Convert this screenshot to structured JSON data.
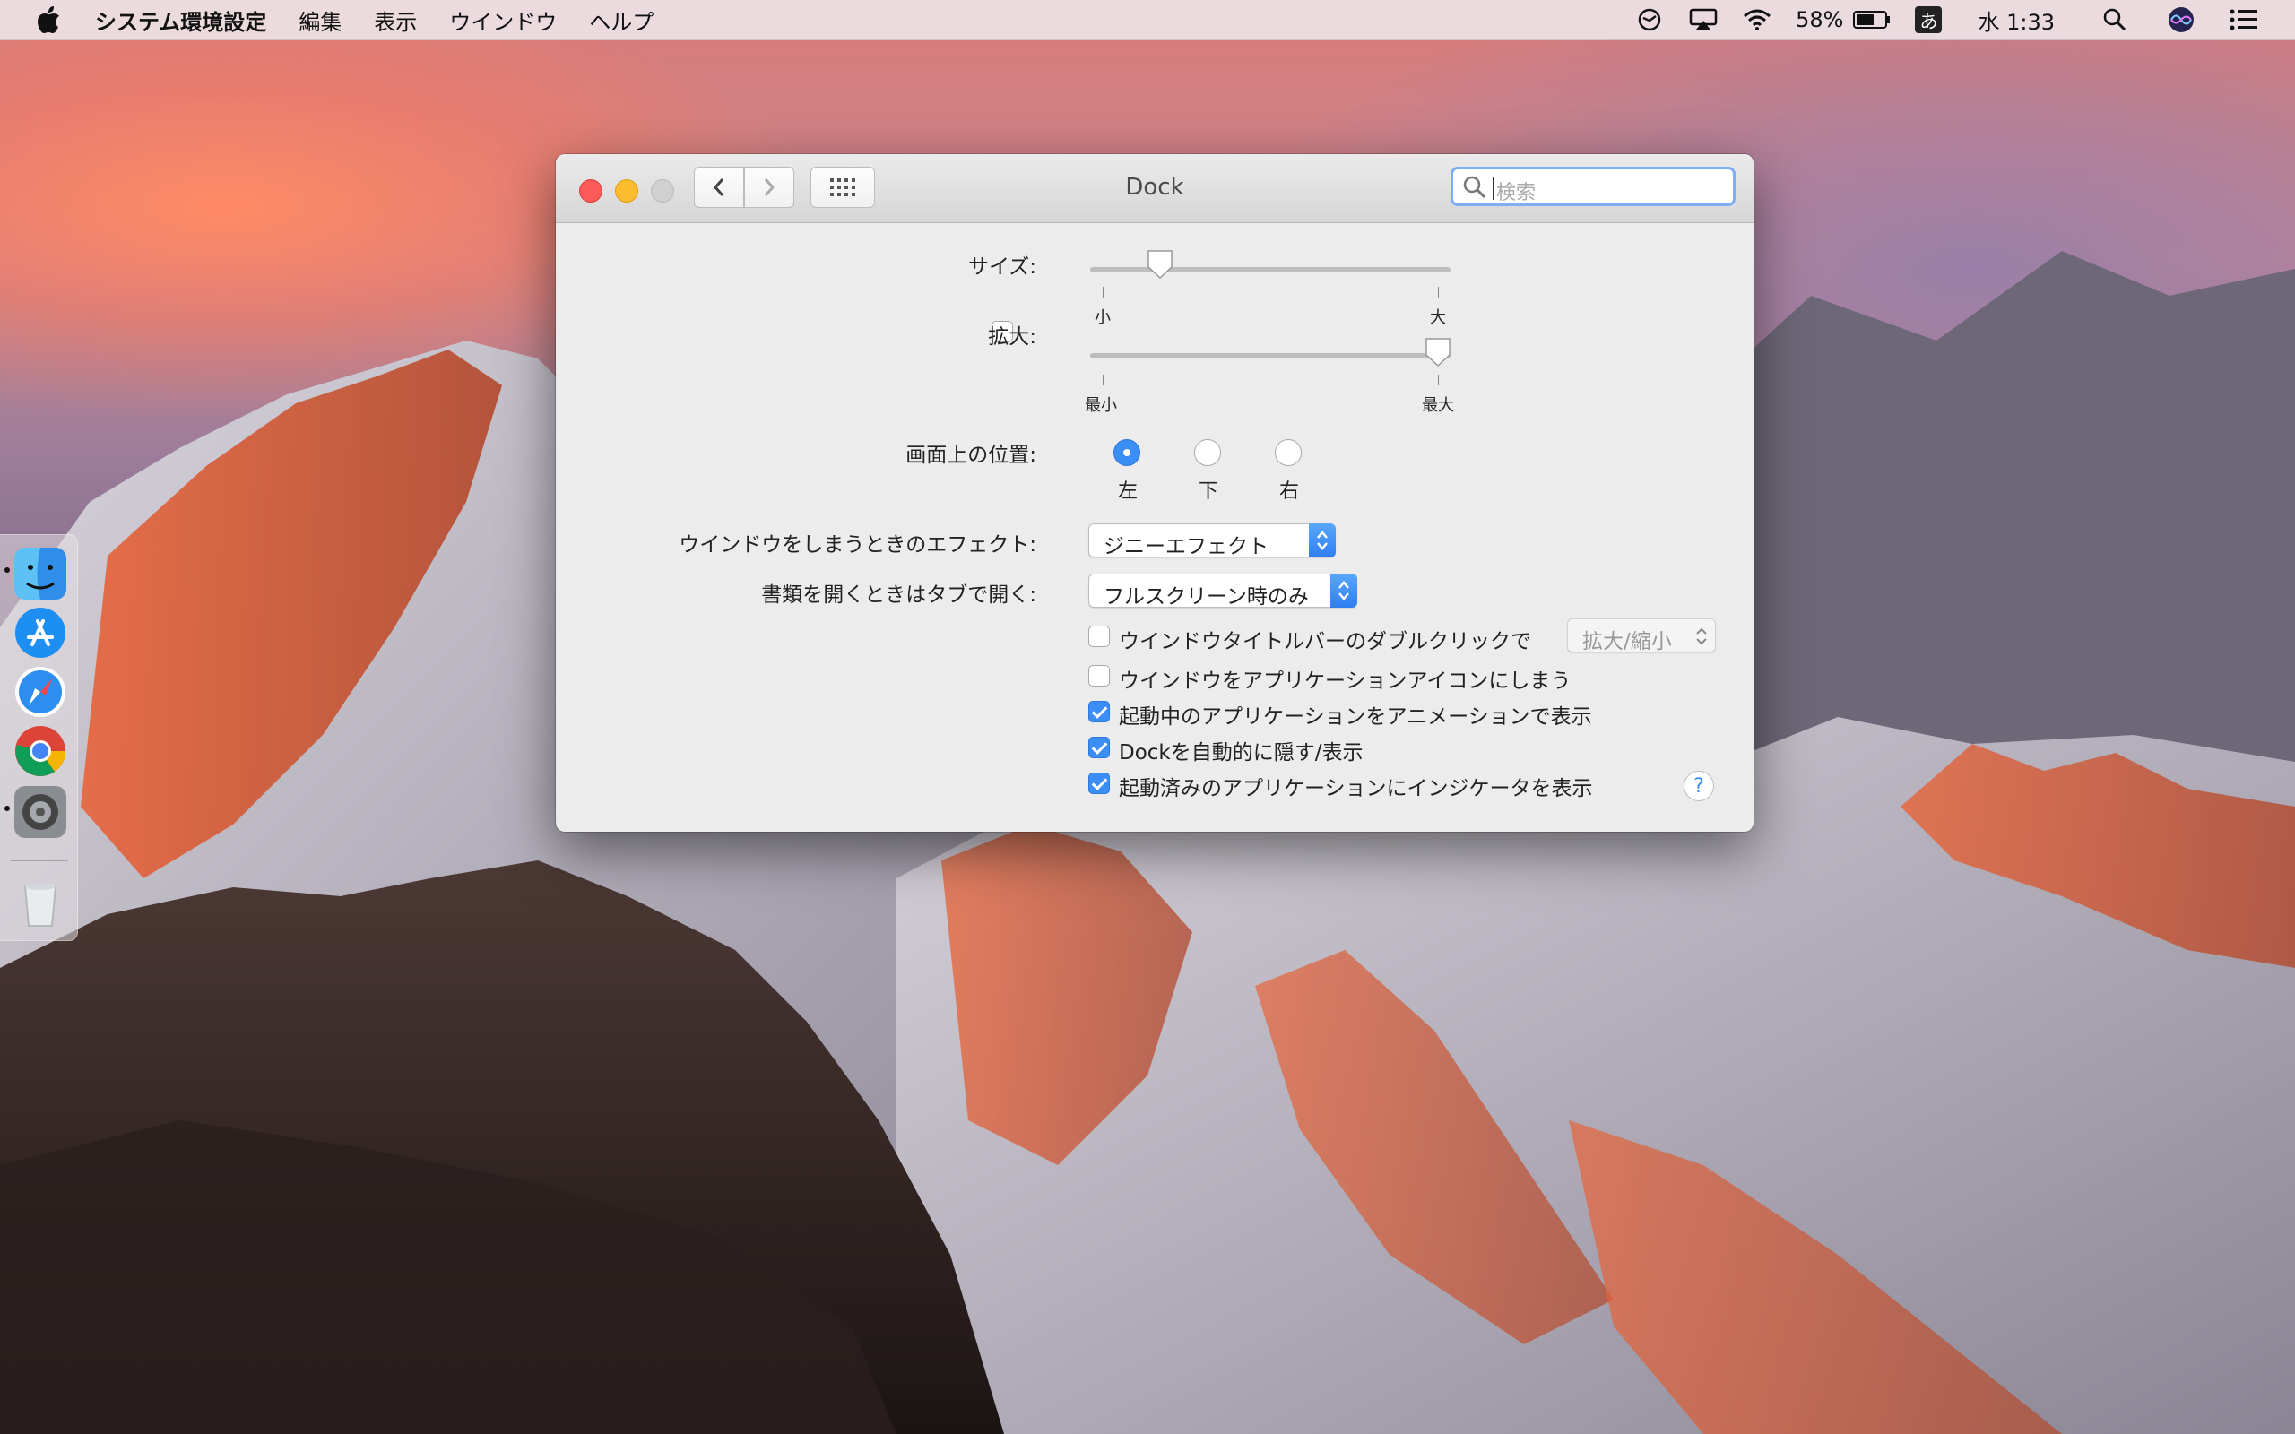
{
  "menubar": {
    "app_name": "システム環境設定",
    "menus": [
      "編集",
      "表示",
      "ウインドウ",
      "ヘルプ"
    ],
    "battery": "58%",
    "ime": "あ",
    "clock": "水 1:33"
  },
  "window": {
    "title": "Dock",
    "search_placeholder": "検索"
  },
  "settings": {
    "size_label": "サイズ:",
    "size_min": "小",
    "size_max": "大",
    "size_value": 0.17,
    "magnify_label": "拡大:",
    "magnify_checked": false,
    "magnify_min": "最小",
    "magnify_max": "最大",
    "magnify_value": 1.0,
    "position_label": "画面上の位置:",
    "position_options": [
      "左",
      "下",
      "右"
    ],
    "position_selected": "左",
    "effect_label": "ウインドウをしまうときのエフェクト:",
    "effect_value": "ジニーエフェクト",
    "tabs_label": "書類を開くときはタブで開く:",
    "tabs_value": "フルスクリーン時のみ",
    "options": [
      {
        "label": "ウインドウタイトルバーのダブルクリックで",
        "checked": false
      },
      {
        "label": "ウインドウをアプリケーションアイコンにしまう",
        "checked": false
      },
      {
        "label": "起動中のアプリケーションをアニメーションで表示",
        "checked": true
      },
      {
        "label": "Dockを自動的に隠す/表示",
        "checked": true
      },
      {
        "label": "起動済みのアプリケーションにインジケータを表示",
        "checked": true
      }
    ],
    "double_click_action": "拡大/縮小",
    "help": "?"
  },
  "dock": {
    "items": [
      "finder-icon",
      "app-store-icon",
      "safari-icon",
      "chrome-icon",
      "system-preferences-icon",
      "trash-icon"
    ]
  }
}
